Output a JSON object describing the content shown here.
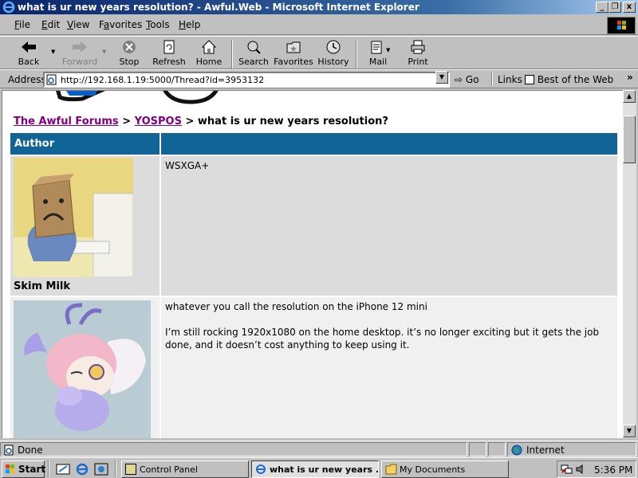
{
  "window": {
    "title": "what is ur new years resolution? - Awful.Web - Microsoft Internet Explorer",
    "minimize": "_",
    "maximize": "❐",
    "close": "x"
  },
  "menu": [
    {
      "label": "File",
      "key": "F"
    },
    {
      "label": "Edit",
      "key": "E"
    },
    {
      "label": "View",
      "key": "V"
    },
    {
      "label": "Favorites",
      "key": "a"
    },
    {
      "label": "Tools",
      "key": "T"
    },
    {
      "label": "Help",
      "key": "H"
    }
  ],
  "toolbar": {
    "back": "Back",
    "forward": "Forward",
    "stop": "Stop",
    "refresh": "Refresh",
    "home": "Home",
    "search": "Search",
    "favorites": "Favorites",
    "history": "History",
    "mail": "Mail",
    "print": "Print"
  },
  "address": {
    "label": "Address",
    "url": "http://192.168.1.19:5000/Thread?id=3953132",
    "go": "Go",
    "links": "Links",
    "best_of_web": "Best of the Web"
  },
  "breadcrumb": {
    "forum": "The Awful Forums",
    "sep1": ">",
    "subforum": "YOSPOS",
    "sep2": ">",
    "thread": "what is ur new years resolution?"
  },
  "thread": {
    "author_header": "Author",
    "posts": [
      {
        "username": "Skim Milk",
        "body": [
          "WSXGA+"
        ]
      },
      {
        "username": "",
        "body": [
          "whatever you call the resolution on the iPhone 12 mini",
          "I’m still rocking 1920x1080 on the home desktop. it’s no longer exciting but it gets the job done, and it doesn’t cost anything to keep using it."
        ]
      }
    ]
  },
  "status": {
    "text": "Done",
    "zone": "Internet"
  },
  "taskbar": {
    "start": "Start",
    "tasks": [
      {
        "label": "Control Panel"
      },
      {
        "label": "what is ur new years ..."
      },
      {
        "label": "My Documents"
      }
    ],
    "clock": "5:36 PM"
  },
  "colors": {
    "title_bar": "#0a246a",
    "header_blue": "#106496",
    "visited_link": "#800080"
  }
}
